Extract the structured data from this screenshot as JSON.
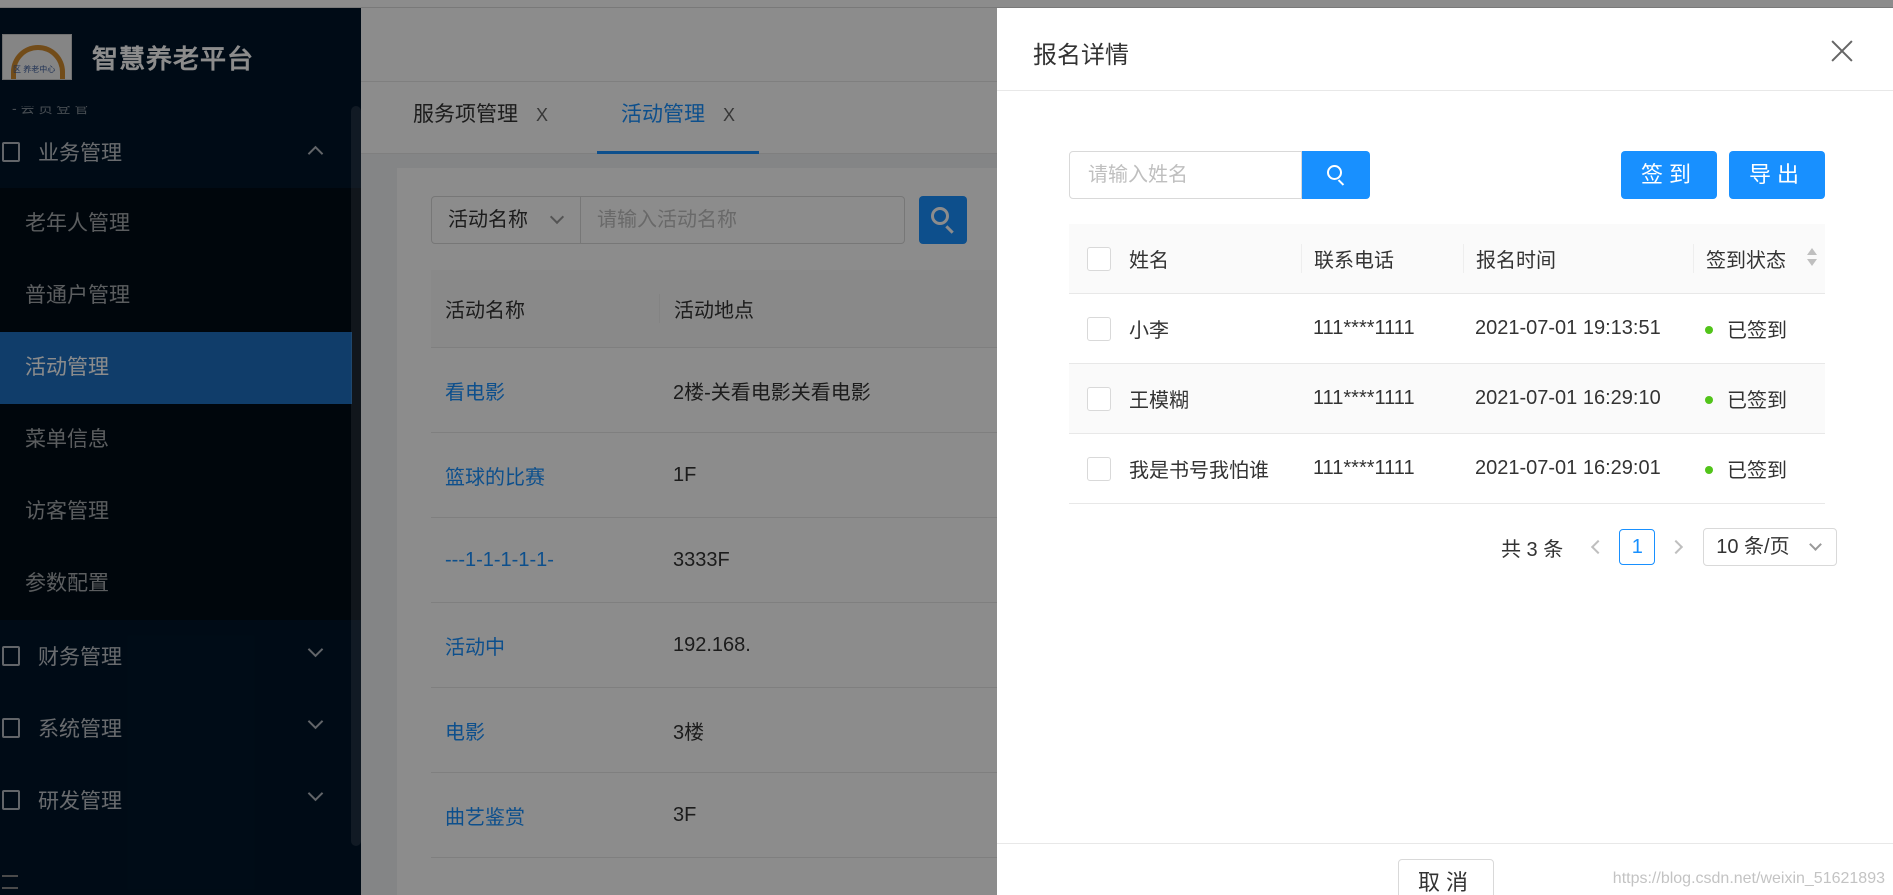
{
  "app": {
    "title": "智慧养老平台",
    "logo_text": "区 养老中心"
  },
  "sidebar": {
    "partial_top": "- 会 员 登 管",
    "group_business": "业务管理",
    "items": [
      {
        "label": "老年人管理"
      },
      {
        "label": "普通户管理"
      },
      {
        "label": "活动管理",
        "active": true
      },
      {
        "label": "菜单信息"
      },
      {
        "label": "访客管理"
      },
      {
        "label": "参数配置"
      }
    ],
    "group_finance": "财务管理",
    "group_system": "系统管理",
    "group_dev": "研发管理"
  },
  "tabs": [
    {
      "label": "服务项管理",
      "close": "X"
    },
    {
      "label": "活动管理",
      "close": "X",
      "active": true
    }
  ],
  "filter": {
    "select_value": "活动名称",
    "input_placeholder": "请输入活动名称"
  },
  "bg_table": {
    "columns": [
      "活动名称",
      "活动地点"
    ],
    "rows": [
      [
        "看电影",
        "2楼-关看电影关看电影"
      ],
      [
        "篮球的比赛",
        "1F"
      ],
      [
        "---1-1-1-1-1-",
        "3333F"
      ],
      [
        "活动中",
        "192.168."
      ],
      [
        "电影",
        "3楼"
      ],
      [
        "曲艺鉴赏",
        "3F"
      ],
      [
        "",
        ""
      ]
    ]
  },
  "drawer": {
    "title": "报名详情",
    "search_placeholder": "请输入姓名",
    "sign_button": "签到",
    "export_button": "导出",
    "columns": {
      "name": "姓名",
      "phone": "联系电话",
      "time": "报名时间",
      "status": "签到状态"
    },
    "rows": [
      {
        "name": "小李",
        "phone": "111****1111",
        "time": "2021-07-01 19:13:51",
        "status": "已签到"
      },
      {
        "name": "王模糊",
        "phone": "111****1111",
        "time": "2021-07-01 16:29:10",
        "status": "已签到"
      },
      {
        "name": "我是书号我怕谁",
        "phone": "111****1111",
        "time": "2021-07-01 16:29:01",
        "status": "已签到"
      }
    ],
    "pagination": {
      "total": "共 3 条",
      "current": "1",
      "page_size": "10 条/页"
    },
    "cancel_button": "取消"
  },
  "watermark": "https://blog.csdn.net/weixin_51621893",
  "colors": {
    "primary": "#1890ff",
    "sidebar_bg": "#001529",
    "active_menu": "#1e70c2",
    "success": "#52c41a"
  }
}
